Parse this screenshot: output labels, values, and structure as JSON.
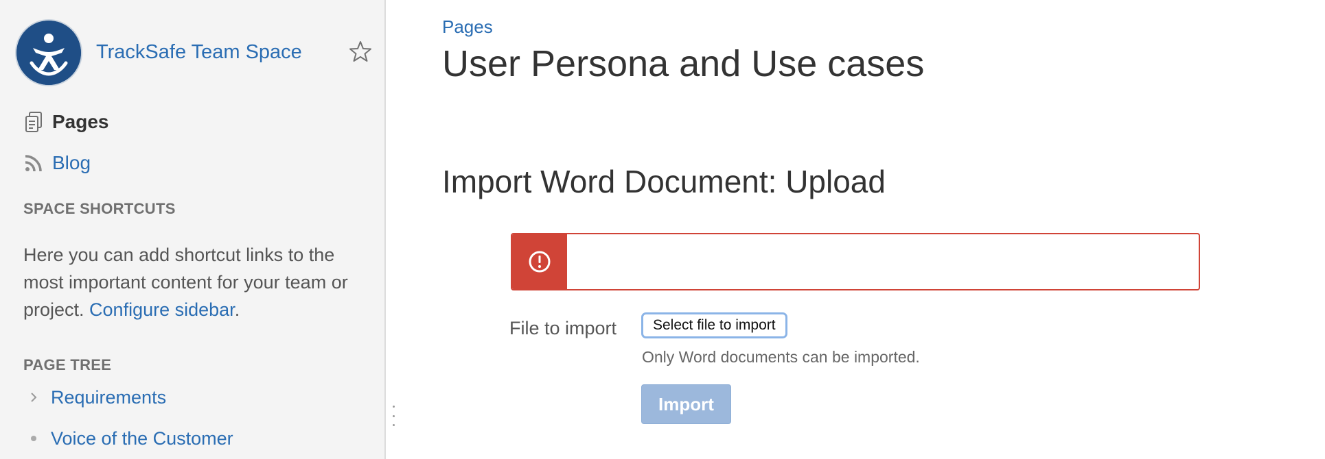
{
  "sidebar": {
    "space_title": "TrackSafe Team Space",
    "nav": {
      "pages_label": "Pages",
      "blog_label": "Blog"
    },
    "shortcuts": {
      "heading": "SPACE SHORTCUTS",
      "text": "Here you can add shortcut links to the most important content for your team or project.",
      "link_label": "Configure sidebar",
      "after_link": "."
    },
    "page_tree": {
      "heading": "PAGE TREE",
      "items": [
        {
          "label": "Requirements",
          "icon": "chevron-right-icon"
        },
        {
          "label": "Voice of the Customer",
          "icon": "bullet-icon"
        }
      ]
    }
  },
  "main": {
    "breadcrumb": "Pages",
    "page_title": "User Persona and Use cases",
    "section_title": "Import Word Document: Upload",
    "form": {
      "file_label": "File to import",
      "select_button": "Select file to import",
      "hint": "Only Word documents can be imported.",
      "import_button": "Import"
    }
  },
  "colors": {
    "link": "#2a6db3",
    "error": "#d04437",
    "sidebar_bg": "#f4f4f4",
    "import_disabled": "#9cb8dc"
  }
}
